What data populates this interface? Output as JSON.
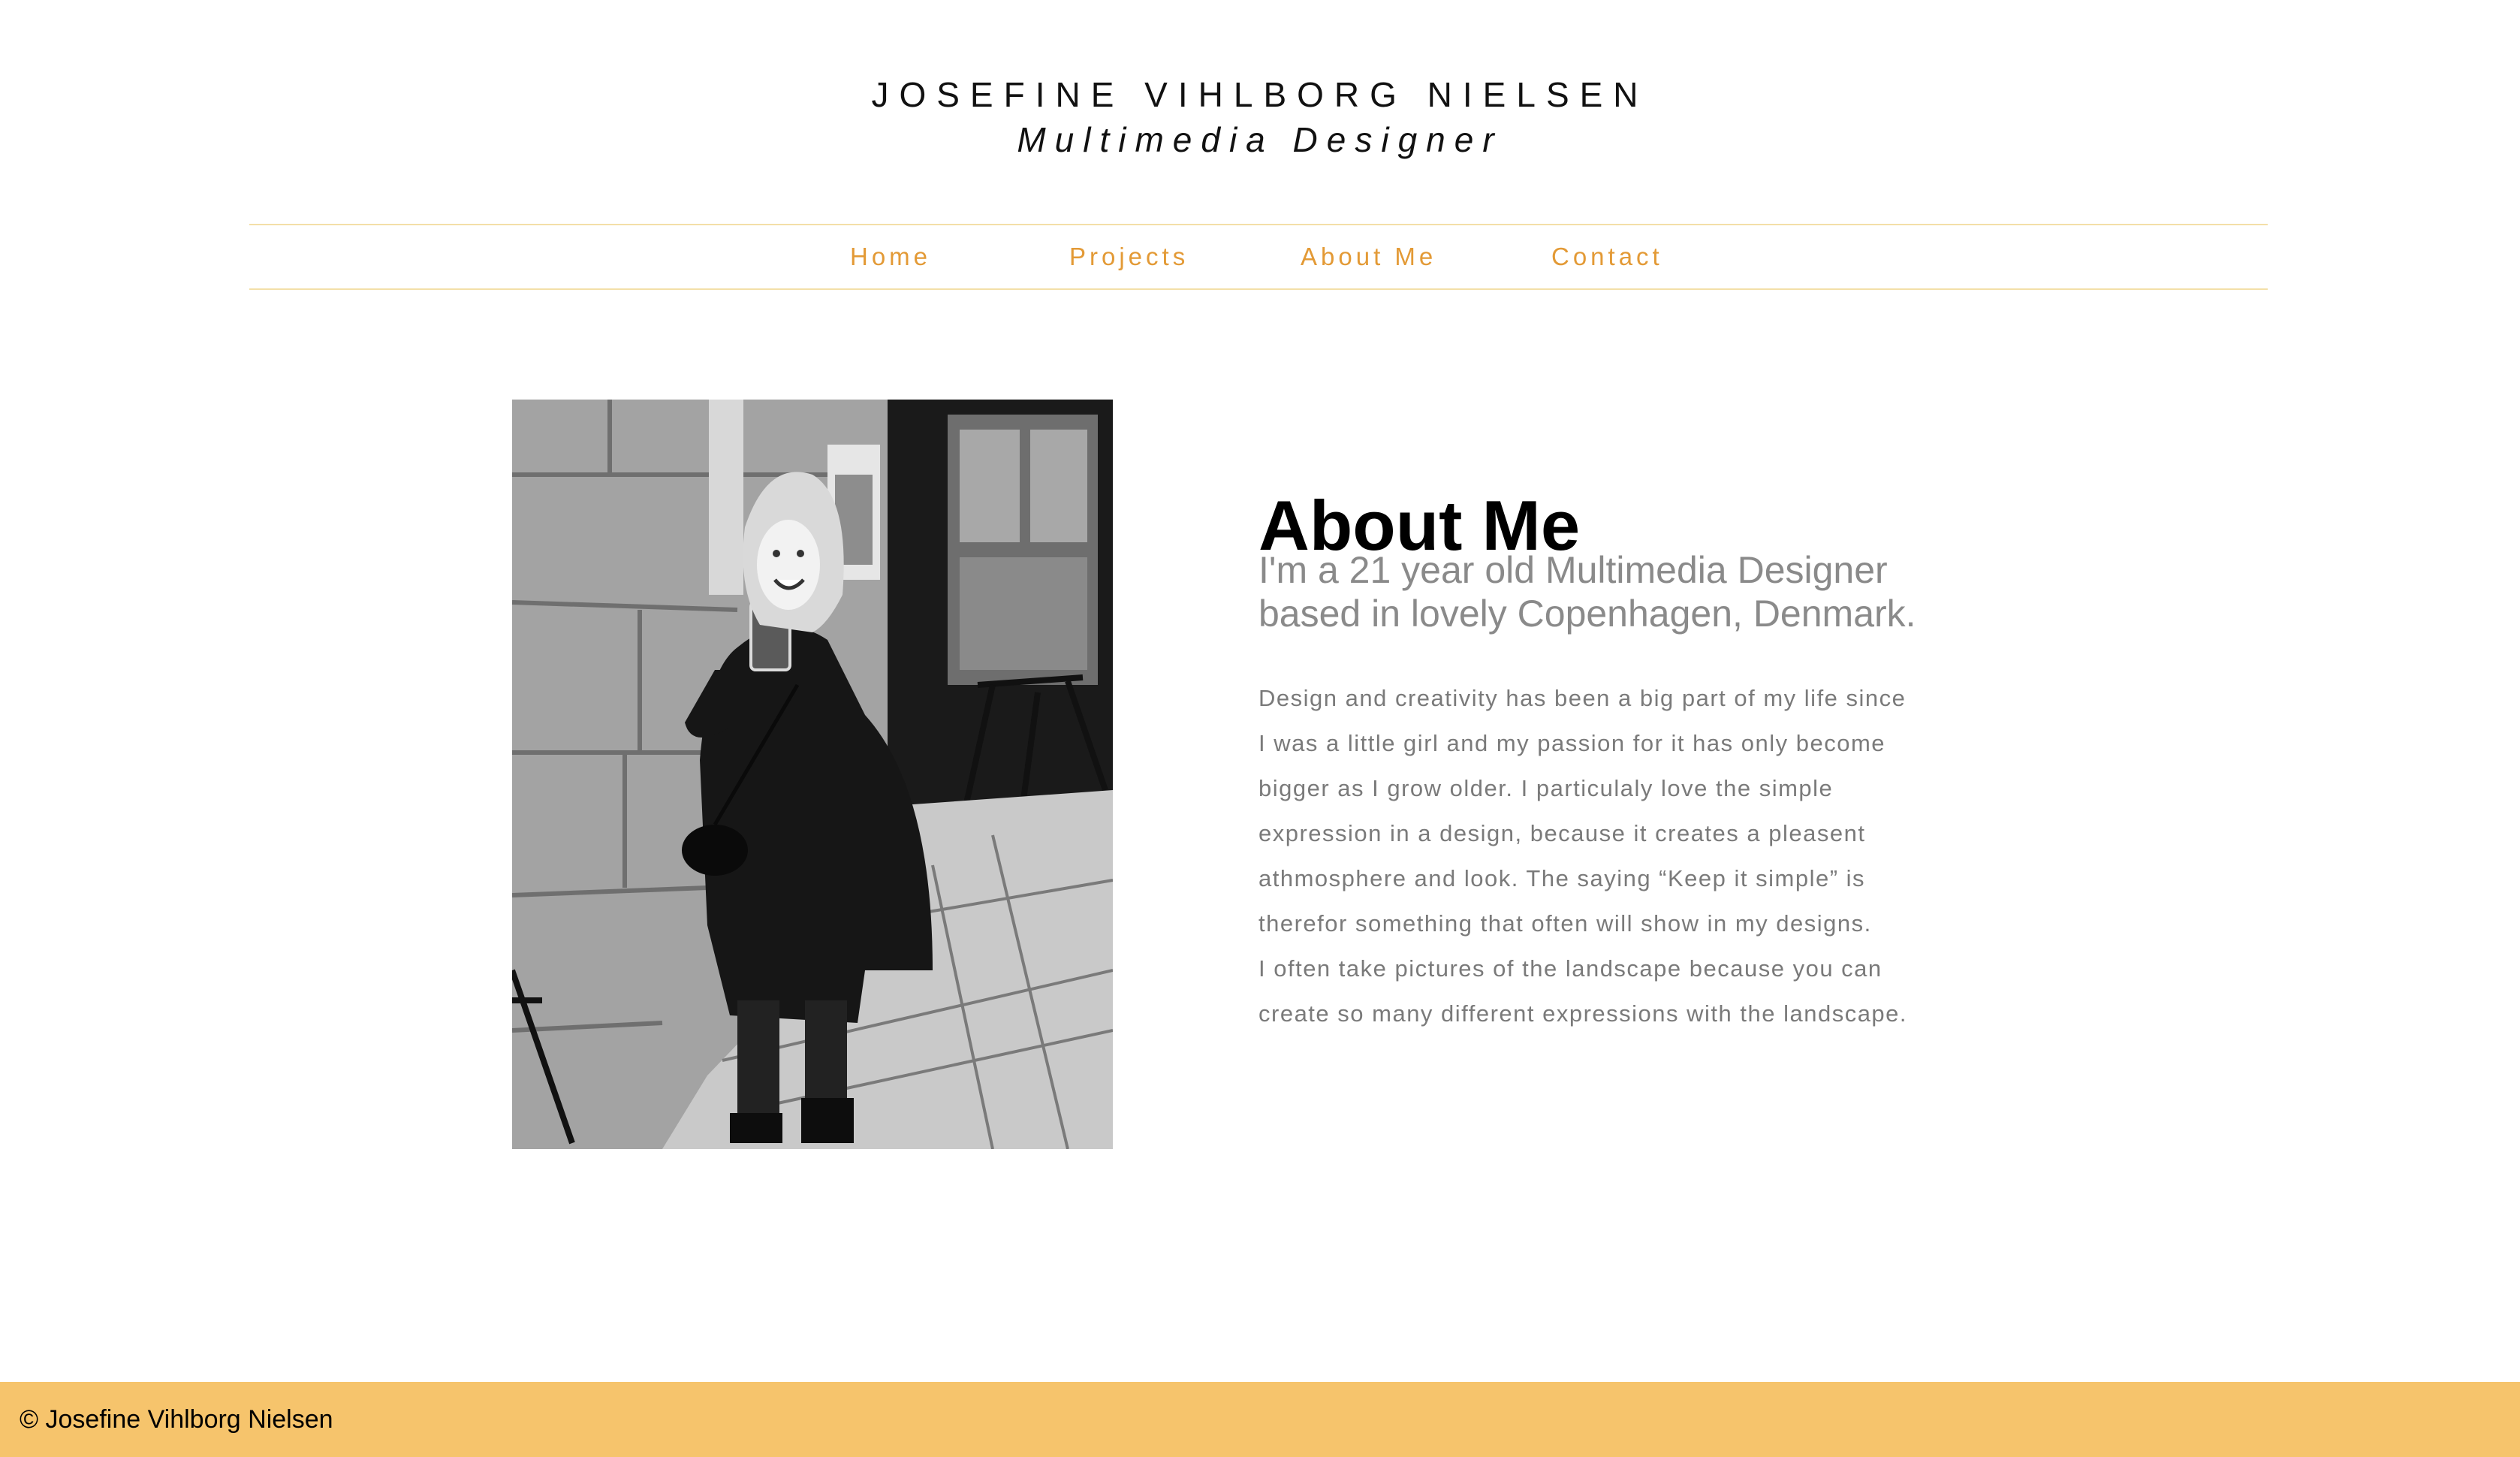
{
  "header": {
    "name": "JOSEFINE VIHLBORG NIELSEN",
    "tagline": "Multimedia Designer"
  },
  "nav": {
    "items": [
      {
        "label": "Home"
      },
      {
        "label": "Projects"
      },
      {
        "label": "About Me"
      },
      {
        "label": "Contact"
      }
    ]
  },
  "about": {
    "title": "About Me",
    "lead_lines": [
      "I'm a 21 year old Multimedia Designer",
      "based in lovely Copenhagen, Denmark."
    ],
    "body_lines": [
      "Design and creativity has been a big part of my life since",
      "I was a little girl and my passion for it has only become",
      "bigger as I grow older. I particulaly love the simple",
      "expression in a design, because it creates a pleasent",
      "athmosphere and look. The saying “Keep it simple” is",
      "therefor something that often will show in my designs.",
      "I often take pictures of the landscape because you can",
      "create so many different expressions with the landscape."
    ]
  },
  "footer": {
    "text": "© Josefine Vihlborg Nielsen"
  },
  "colors": {
    "accent": "#e39a36",
    "nav_border": "#f3dfa8",
    "footer_bg": "#f6c46c",
    "muted_text": "#7a7a7a"
  }
}
